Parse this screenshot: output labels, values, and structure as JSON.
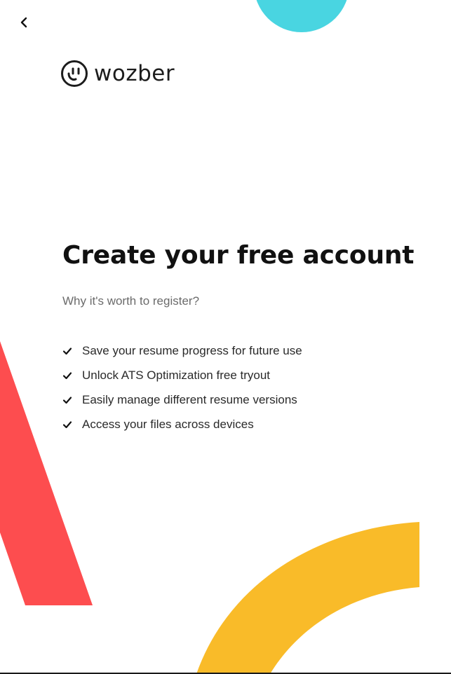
{
  "navigation": {
    "back_icon": "chevron-left-icon"
  },
  "brand": {
    "name": "wozber",
    "logo_icon": "wozber-face-icon"
  },
  "main": {
    "title": "Create your free account",
    "subtitle": "Why it's worth to register?",
    "benefits": [
      {
        "label": "Save your resume progress for future use",
        "icon": "check-icon"
      },
      {
        "label": "Unlock ATS Optimization free tryout",
        "icon": "check-icon"
      },
      {
        "label": "Easily manage different resume versions",
        "icon": "check-icon"
      },
      {
        "label": "Access your files across devices",
        "icon": "check-icon"
      }
    ]
  },
  "colors": {
    "cyan": "#49d5e1",
    "red": "#fd4d4f",
    "yellow": "#f9bb29",
    "text": "#111111",
    "muted": "#6b6b6b"
  }
}
